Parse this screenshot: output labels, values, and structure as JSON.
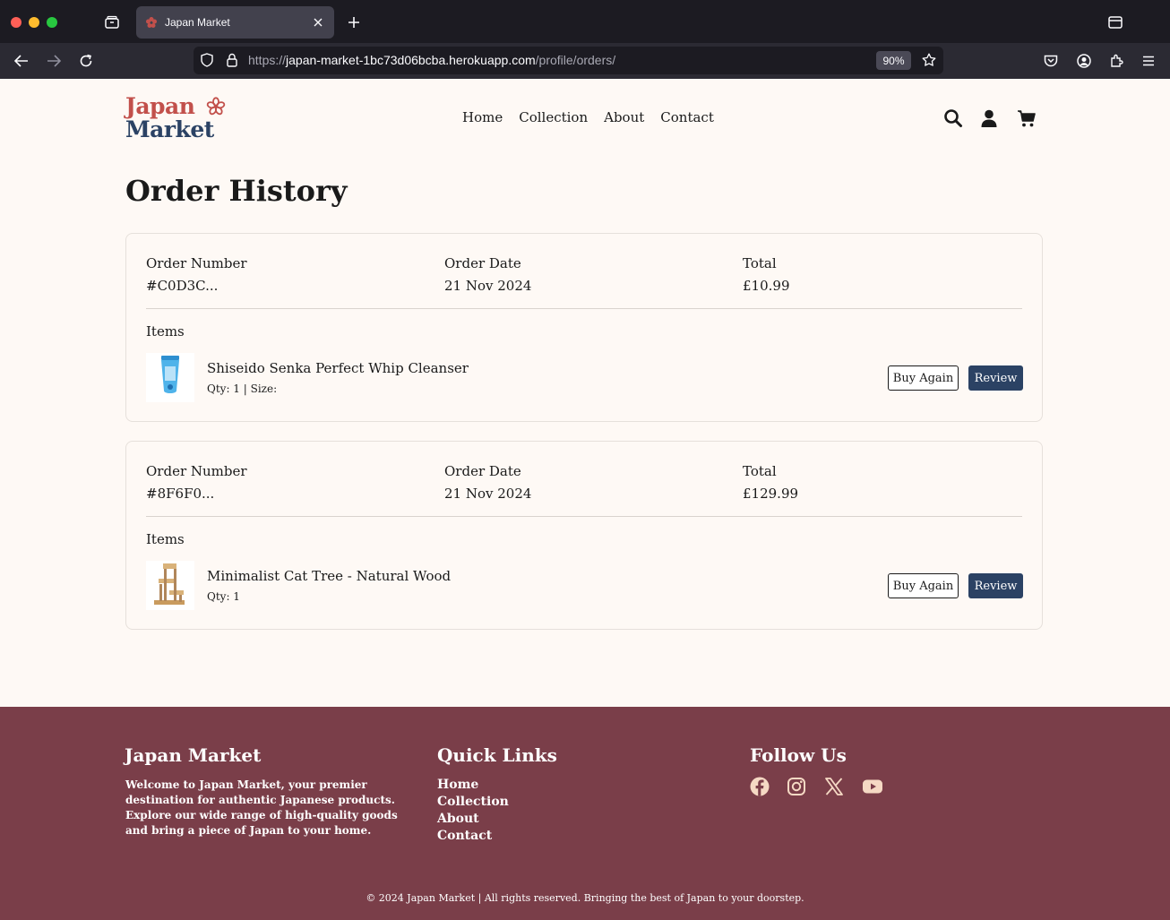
{
  "browser": {
    "tab_title": "Japan Market",
    "url_prefix": "https://",
    "url_host": "japan-market-1bc73d06bcba.herokuapp.com",
    "url_path": "/profile/orders/",
    "zoom": "90%"
  },
  "header": {
    "logo_line1": "Japan",
    "logo_line2": "Market",
    "nav": [
      "Home",
      "Collection",
      "About",
      "Contact"
    ]
  },
  "page_title": "Order History",
  "labels": {
    "order_number": "Order Number",
    "order_date": "Order Date",
    "total": "Total",
    "items": "Items",
    "buy_again": "Buy Again",
    "review": "Review"
  },
  "orders": [
    {
      "number": "#C0D3C...",
      "date": "21 Nov 2024",
      "total": "£10.99",
      "item_name": "Shiseido Senka Perfect Whip Cleanser",
      "item_meta": "Qty: 1 | Size:"
    },
    {
      "number": "#8F6F0...",
      "date": "21 Nov 2024",
      "total": "£129.99",
      "item_name": "Minimalist Cat Tree - Natural Wood",
      "item_meta": "Qty: 1"
    }
  ],
  "footer": {
    "brand_heading": "Japan Market",
    "about": "Welcome to Japan Market, your premier destination for authentic Japanese products. Explore our wide range of high-quality goods and bring a piece of Japan to your home.",
    "quick_links_heading": "Quick Links",
    "links": [
      "Home",
      "Collection",
      "About",
      "Contact"
    ],
    "follow_heading": "Follow Us",
    "social_icons": [
      "facebook-icon",
      "instagram-icon",
      "x-icon",
      "youtube-icon"
    ],
    "copyright": "© 2024 Japan Market | All rights reserved. Bringing the best of Japan to your doorstep."
  },
  "colors": {
    "brand_red": "#c2504b",
    "brand_navy": "#2b4264",
    "footer_bg": "#7a3e49",
    "page_bg": "#fef9f5",
    "footer_text": "#f5d9c4"
  }
}
